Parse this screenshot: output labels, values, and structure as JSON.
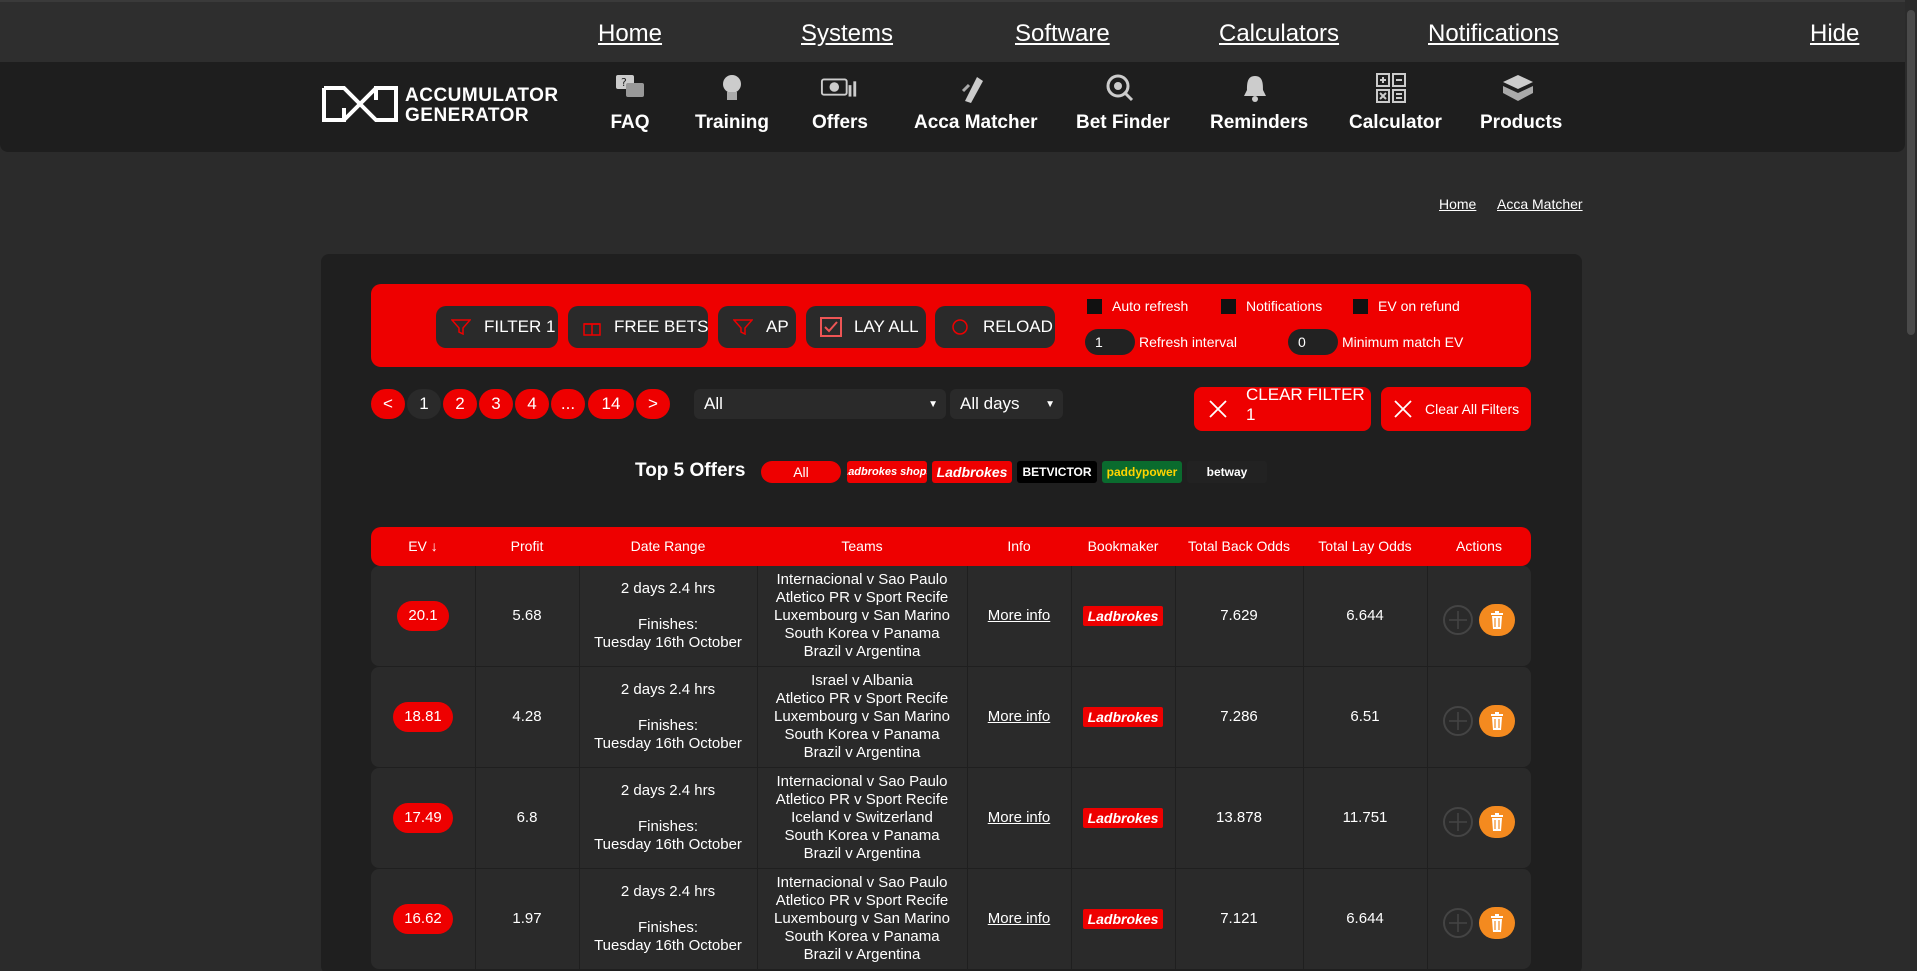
{
  "topnav": {
    "home": "Home",
    "systems": "Systems",
    "software": "Software",
    "calculators": "Calculators",
    "notifications": "Notifications",
    "hide": "Hide"
  },
  "logo": {
    "line1": "ACCUMULATOR",
    "line2": "GENERATOR"
  },
  "mainnav": [
    {
      "label": "FAQ",
      "icon": "faq-icon"
    },
    {
      "label": "Training",
      "icon": "lightbulb-icon"
    },
    {
      "label": "Offers",
      "icon": "money-icon"
    },
    {
      "label": "Acca Matcher",
      "icon": "acca-matcher-icon"
    },
    {
      "label": "Bet Finder",
      "icon": "search-target-icon"
    },
    {
      "label": "Reminders",
      "icon": "bell-icon"
    },
    {
      "label": "Calculator",
      "icon": "calculator-icon"
    },
    {
      "label": "Products",
      "icon": "box-icon"
    }
  ],
  "breadcrumb": {
    "home": "Home",
    "current": "Acca Matcher"
  },
  "toolbar": {
    "filter": "FILTER 1",
    "free_bets": "FREE BETS",
    "ap": "AP",
    "lay_all": "LAY ALL",
    "reload": "RELOAD",
    "auto_refresh": "Auto refresh",
    "notifications": "Notifications",
    "ev_on_refund": "EV on refund",
    "refresh_interval_value": "1",
    "refresh_interval_label": "Refresh interval",
    "min_ev_value": "0",
    "min_ev_label": "Minimum match EV"
  },
  "pagination": {
    "prev": "<",
    "pages": [
      "1",
      "2",
      "3",
      "4",
      "...",
      "14"
    ],
    "next": ">"
  },
  "filters": {
    "bookmaker_select": "All",
    "days_select": "All days",
    "clear_filter": "CLEAR FILTER 1",
    "clear_all": "Clear All Filters"
  },
  "top5": {
    "title": "Top 5 Offers",
    "all": "All",
    "logos": [
      "Ladbrokes shops",
      "Ladbrokes",
      "BETVICTOR",
      "paddypower",
      "betway"
    ]
  },
  "table": {
    "headers": [
      "EV ↓",
      "Profit",
      "Date Range",
      "Teams",
      "Info",
      "Bookmaker",
      "Total Back Odds",
      "Total Lay Odds",
      "Actions"
    ],
    "rows": [
      {
        "ev": "20.1",
        "profit": "5.68",
        "date_line1": "2 days 2.4 hrs",
        "date_line2": "Finishes:",
        "date_line3": "Tuesday 16th October",
        "teams": [
          "Internacional v Sao Paulo",
          "Atletico PR v Sport Recife",
          "Luxembourg v San Marino",
          "South Korea v Panama",
          "Brazil v Argentina"
        ],
        "info": "More info",
        "bookmaker": "Ladbrokes",
        "back_odds": "7.629",
        "lay_odds": "6.644"
      },
      {
        "ev": "18.81",
        "profit": "4.28",
        "date_line1": "2 days 2.4 hrs",
        "date_line2": "Finishes:",
        "date_line3": "Tuesday 16th October",
        "teams": [
          "Israel v Albania",
          "Atletico PR v Sport Recife",
          "Luxembourg v San Marino",
          "South Korea v Panama",
          "Brazil v Argentina"
        ],
        "info": "More info",
        "bookmaker": "Ladbrokes",
        "back_odds": "7.286",
        "lay_odds": "6.51"
      },
      {
        "ev": "17.49",
        "profit": "6.8",
        "date_line1": "2 days 2.4 hrs",
        "date_line2": "Finishes:",
        "date_line3": "Tuesday 16th October",
        "teams": [
          "Internacional v Sao Paulo",
          "Atletico PR v Sport Recife",
          "Iceland v Switzerland",
          "South Korea v Panama",
          "Brazil v Argentina"
        ],
        "info": "More info",
        "bookmaker": "Ladbrokes",
        "back_odds": "13.878",
        "lay_odds": "11.751"
      },
      {
        "ev": "16.62",
        "profit": "1.97",
        "date_line1": "2 days 2.4 hrs",
        "date_line2": "Finishes:",
        "date_line3": "Tuesday 16th October",
        "teams": [
          "Internacional v Sao Paulo",
          "Atletico PR v Sport Recife",
          "Luxembourg v San Marino",
          "South Korea v Panama",
          "Brazil v Argentina"
        ],
        "info": "More info",
        "bookmaker": "Ladbrokes",
        "back_odds": "7.121",
        "lay_odds": "6.644"
      }
    ]
  },
  "colors": {
    "accent": "#ee0000",
    "panel": "#1f1f1f",
    "row": "#2a2a2a",
    "delete": "#f48a1f"
  }
}
